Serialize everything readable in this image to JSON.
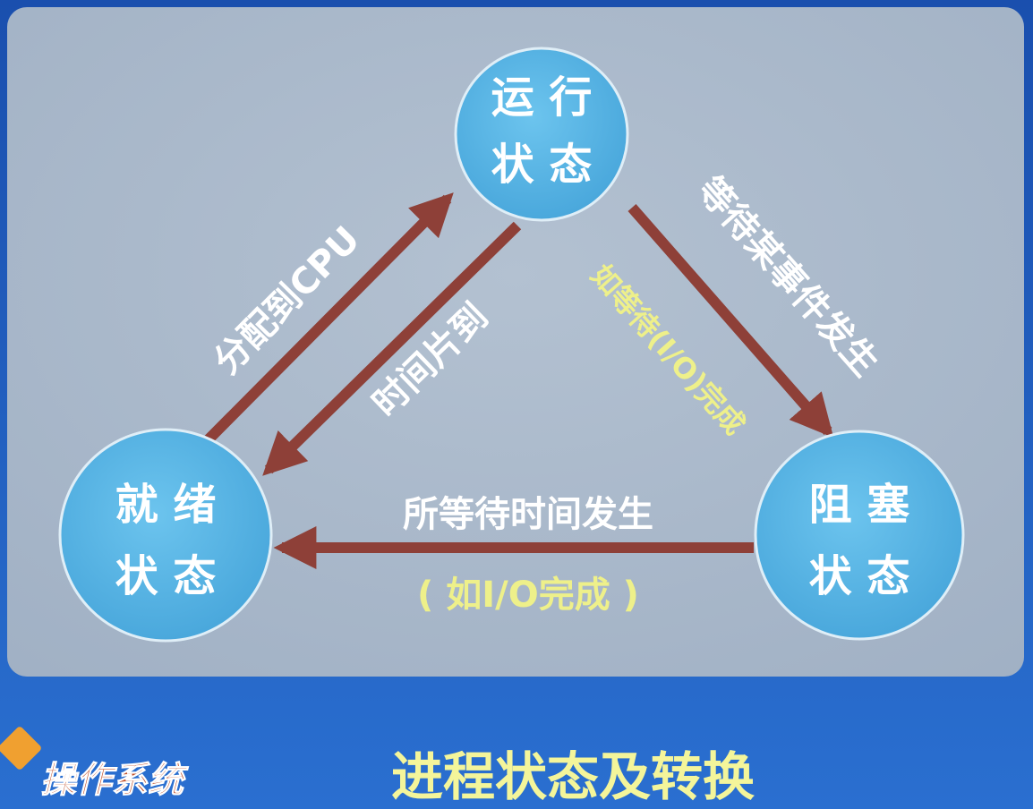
{
  "colors": {
    "panel": "#a7b6c8",
    "circle": "#5cb8e6",
    "arrow": "#8e4038",
    "white_text": "#ffffff",
    "yellow_text": "#eef08a",
    "title": "#f4f59a",
    "band": "#1f5fc0"
  },
  "states": {
    "running": {
      "line1": "运 行",
      "line2": "状 态"
    },
    "ready": {
      "line1": "就 绪",
      "line2": "状 态"
    },
    "blocked": {
      "line1": "阻 塞",
      "line2": "状 态"
    }
  },
  "transitions": {
    "dispatch": "分配到CPU",
    "timeout": "时间片到",
    "wait": "等待某事件发生",
    "wait_example": "如等待(I/O)完成",
    "wakeup": "所等待时间发生",
    "wakeup_example": "( 如I/O完成 )"
  },
  "title": "进程状态及转换",
  "logo": {
    "text": "操作系统"
  }
}
